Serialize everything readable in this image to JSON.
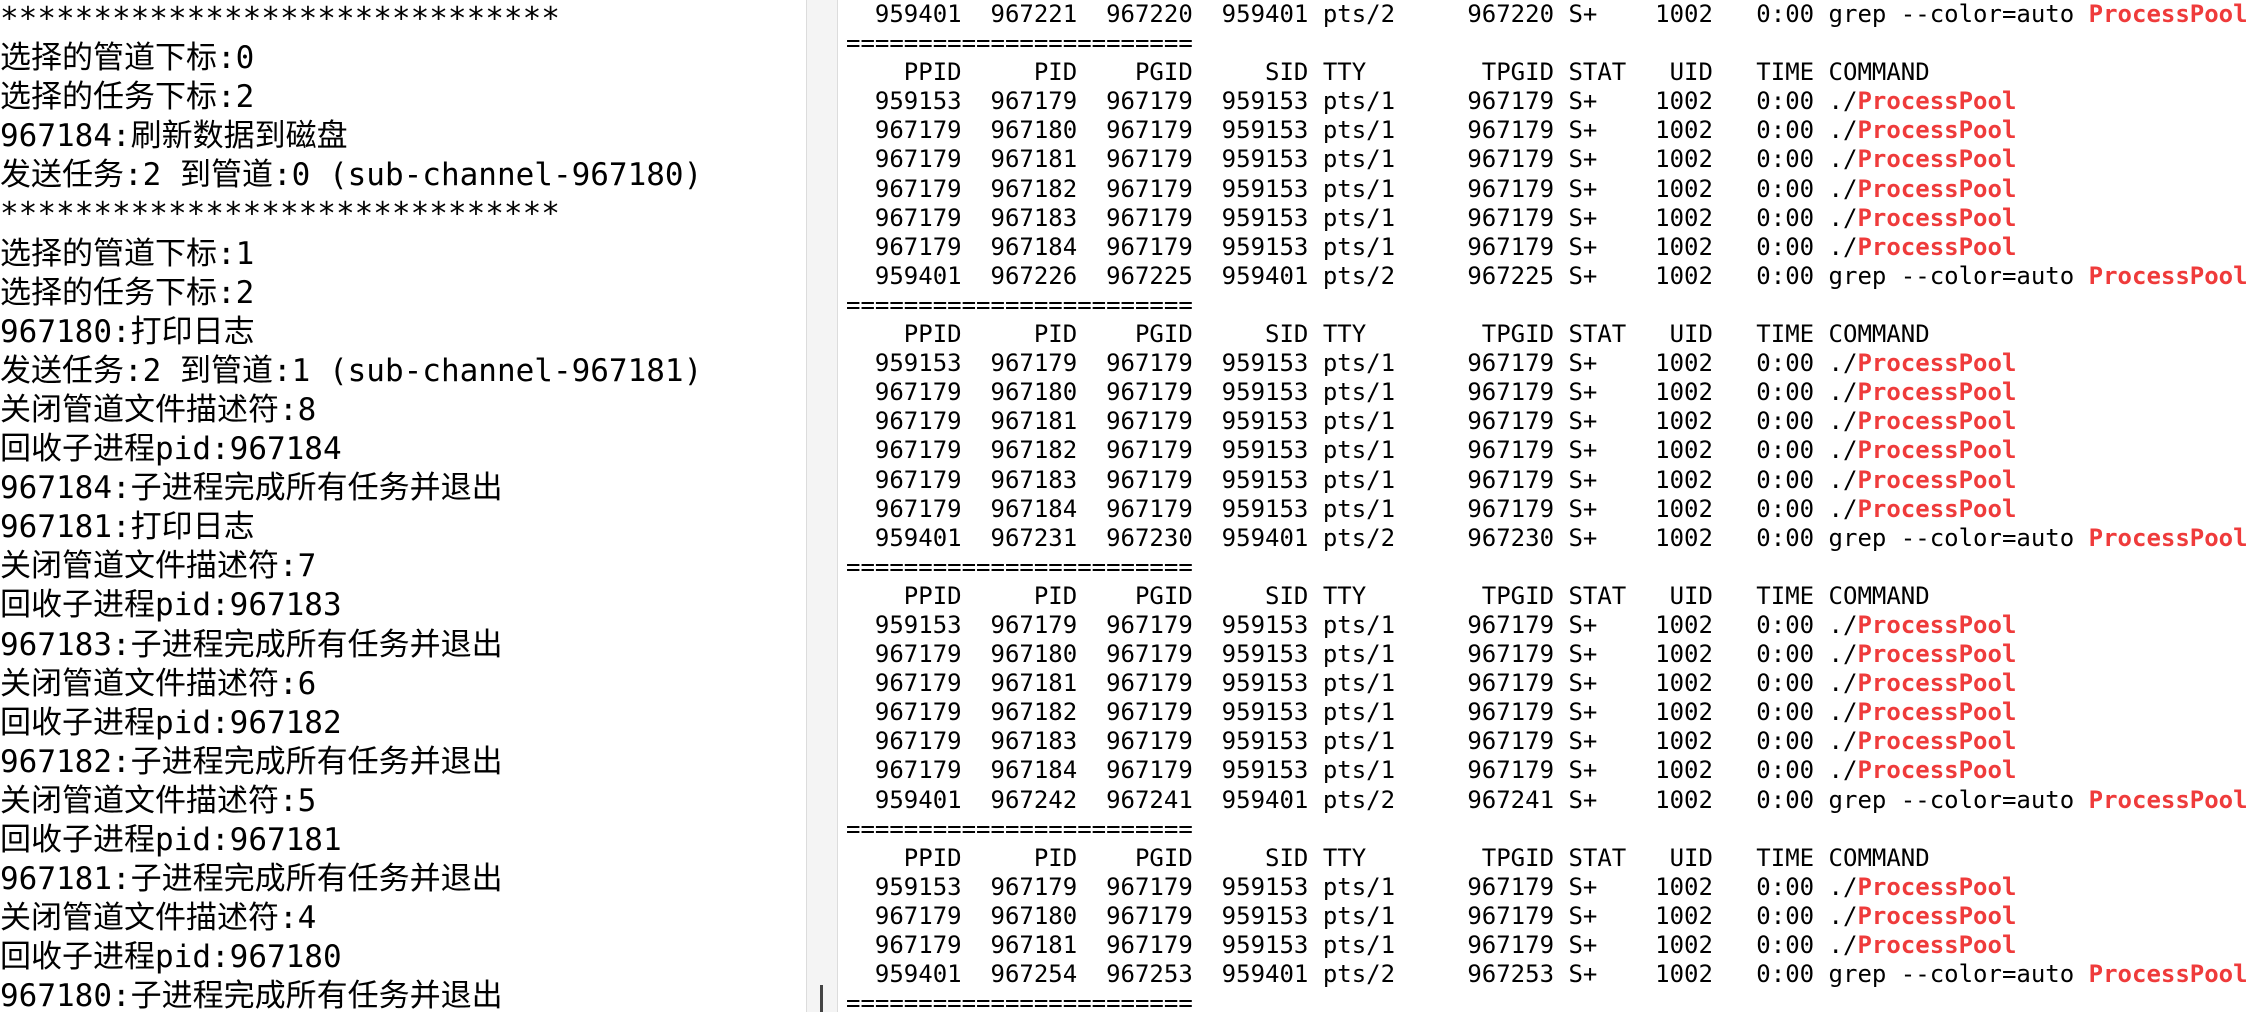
{
  "left_terminal": {
    "lines": [
      "******************************",
      "选择的管道下标:0",
      "选择的任务下标:2",
      "967184:刷新数据到磁盘",
      "发送任务:2 到管道:0 (sub-channel-967180)",
      "******************************",
      "选择的管道下标:1",
      "选择的任务下标:2",
      "967180:打印日志",
      "发送任务:2 到管道:1 (sub-channel-967181)",
      "关闭管道文件描述符:8",
      "回收子进程pid:967184",
      "967184:子进程完成所有任务并退出",
      "967181:打印日志",
      "关闭管道文件描述符:7",
      "回收子进程pid:967183",
      "967183:子进程完成所有任务并退出",
      "关闭管道文件描述符:6",
      "回收子进程pid:967182",
      "967182:子进程完成所有任务并退出",
      "关闭管道文件描述符:5",
      "回收子进程pid:967181",
      "967181:子进程完成所有任务并退出",
      "关闭管道文件描述符:4",
      "回收子进程pid:967180",
      "967180:子进程完成所有任务并退出"
    ]
  },
  "right_terminal": {
    "highlight_word": "ProcessPool",
    "highlight_color": "#ef3b3b",
    "lines": [
      "  959401  967221  967220  959401 pts/2     967220 S+    1002   0:00 grep --color=auto ProcessPool",
      "========================",
      "    PPID     PID    PGID     SID TTY        TPGID STAT   UID   TIME COMMAND",
      "  959153  967179  967179  959153 pts/1     967179 S+    1002   0:00 ./ProcessPool",
      "  967179  967180  967179  959153 pts/1     967179 S+    1002   0:00 ./ProcessPool",
      "  967179  967181  967179  959153 pts/1     967179 S+    1002   0:00 ./ProcessPool",
      "  967179  967182  967179  959153 pts/1     967179 S+    1002   0:00 ./ProcessPool",
      "  967179  967183  967179  959153 pts/1     967179 S+    1002   0:00 ./ProcessPool",
      "  967179  967184  967179  959153 pts/1     967179 S+    1002   0:00 ./ProcessPool",
      "  959401  967226  967225  959401 pts/2     967225 S+    1002   0:00 grep --color=auto ProcessPool",
      "========================",
      "    PPID     PID    PGID     SID TTY        TPGID STAT   UID   TIME COMMAND",
      "  959153  967179  967179  959153 pts/1     967179 S+    1002   0:00 ./ProcessPool",
      "  967179  967180  967179  959153 pts/1     967179 S+    1002   0:00 ./ProcessPool",
      "  967179  967181  967179  959153 pts/1     967179 S+    1002   0:00 ./ProcessPool",
      "  967179  967182  967179  959153 pts/1     967179 S+    1002   0:00 ./ProcessPool",
      "  967179  967183  967179  959153 pts/1     967179 S+    1002   0:00 ./ProcessPool",
      "  967179  967184  967179  959153 pts/1     967179 S+    1002   0:00 ./ProcessPool",
      "  959401  967231  967230  959401 pts/2     967230 S+    1002   0:00 grep --color=auto ProcessPool",
      "========================",
      "    PPID     PID    PGID     SID TTY        TPGID STAT   UID   TIME COMMAND",
      "  959153  967179  967179  959153 pts/1     967179 S+    1002   0:00 ./ProcessPool",
      "  967179  967180  967179  959153 pts/1     967179 S+    1002   0:00 ./ProcessPool",
      "  967179  967181  967179  959153 pts/1     967179 S+    1002   0:00 ./ProcessPool",
      "  967179  967182  967179  959153 pts/1     967179 S+    1002   0:00 ./ProcessPool",
      "  967179  967183  967179  959153 pts/1     967179 S+    1002   0:00 ./ProcessPool",
      "  967179  967184  967179  959153 pts/1     967179 S+    1002   0:00 ./ProcessPool",
      "  959401  967242  967241  959401 pts/2     967241 S+    1002   0:00 grep --color=auto ProcessPool",
      "========================",
      "    PPID     PID    PGID     SID TTY        TPGID STAT   UID   TIME COMMAND",
      "  959153  967179  967179  959153 pts/1     967179 S+    1002   0:00 ./ProcessPool",
      "  967179  967180  967179  959153 pts/1     967179 S+    1002   0:00 ./ProcessPool",
      "  967179  967181  967179  959153 pts/1     967179 S+    1002   0:00 ./ProcessPool",
      "  959401  967254  967253  959401 pts/2     967253 S+    1002   0:00 grep --color=auto ProcessPool",
      "========================"
    ]
  }
}
